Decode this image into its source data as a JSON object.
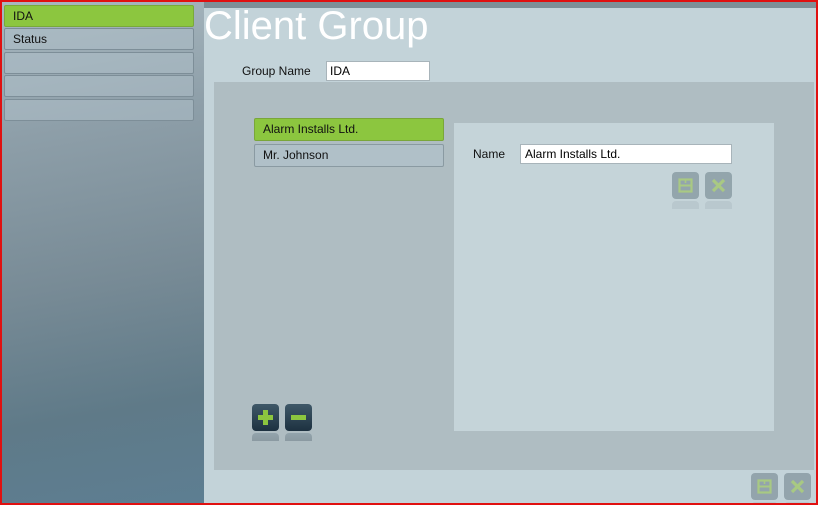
{
  "sidebar": {
    "items": [
      {
        "label": "IDA",
        "active": true
      },
      {
        "label": "Status",
        "active": false
      },
      {
        "label": "",
        "active": false
      },
      {
        "label": "",
        "active": false
      },
      {
        "label": "",
        "active": false
      }
    ]
  },
  "header": {
    "title": "Client Group"
  },
  "group": {
    "label": "Group Name",
    "value": "IDA"
  },
  "clients": {
    "items": [
      {
        "label": "Alarm Installs Ltd.",
        "active": true
      },
      {
        "label": "Mr. Johnson",
        "active": false
      }
    ],
    "add_icon": "plus-icon",
    "remove_icon": "minus-icon"
  },
  "detail": {
    "name_label": "Name",
    "name_value": "Alarm Installs Ltd.",
    "save_icon": "save-icon",
    "cancel_icon": "close-icon"
  },
  "footer": {
    "save_icon": "save-icon",
    "cancel_icon": "close-icon"
  },
  "colors": {
    "accent": "#8cc63f",
    "frame_border": "#e01010",
    "title": "#ffffff"
  }
}
